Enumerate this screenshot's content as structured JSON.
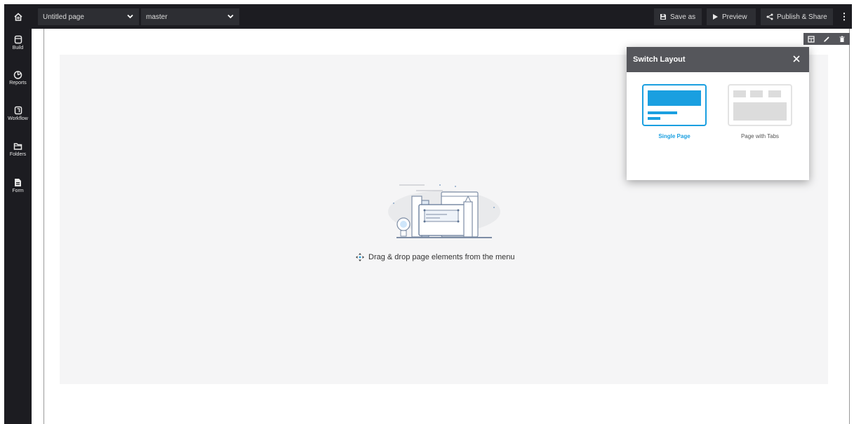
{
  "topbar": {
    "page_select": "Untitled page",
    "branch_select": "master",
    "save_as": "Save as",
    "preview": "Preview",
    "publish_share": "Publish & Share",
    "more": "⋮"
  },
  "sidebar": {
    "items": [
      {
        "label": "Build",
        "icon": "build-icon"
      },
      {
        "label": "Reports",
        "icon": "reports-icon"
      },
      {
        "label": "Workflow",
        "icon": "workflow-icon"
      },
      {
        "label": "Folders",
        "icon": "folders-icon"
      },
      {
        "label": "Form",
        "icon": "form-icon"
      }
    ]
  },
  "canvas": {
    "drop_hint": "Drag & drop page elements from the menu"
  },
  "switch_layout": {
    "title": "Switch Layout",
    "options": [
      {
        "label": "Single Page",
        "selected": true
      },
      {
        "label": "Page with Tabs",
        "selected": false
      }
    ]
  },
  "colors": {
    "accent": "#1a9fe0",
    "dark_bar": "#1c1c21",
    "control_bg": "#2d2e33",
    "popup_header": "#55565b"
  }
}
